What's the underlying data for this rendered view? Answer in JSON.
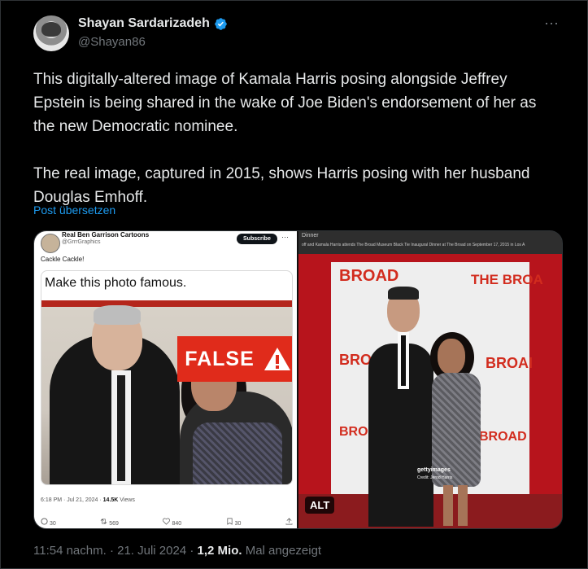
{
  "author": {
    "name": "Shayan Sardarizadeh",
    "handle": "@Shayan86"
  },
  "more_icon": "⋯",
  "tweet": {
    "text": "This digitally-altered image of Kamala Harris posing alongside Jeffrey Epstein is being shared in the wake of Joe Biden's endorsement of her as the new Democratic nominee.\n\nThe real image, captured in 2015, shows Harris posing with her husband Douglas Emhoff.",
    "translate_label": "Post übersetzen"
  },
  "media": {
    "left": {
      "account_name": "Real Ben Garrison Cartoons",
      "account_handle": "@GrrrGraphics",
      "subscribe_label": "Subscribe",
      "dots": "⋯",
      "post_text": "Cackle Cackle!",
      "quoted_text": "Make this photo famous.",
      "false_label": "FALSE",
      "meta_time": "6:18 PM · Jul 21, 2024 · ",
      "meta_views_count": "14.5K",
      "meta_views_label": " Views",
      "actions": {
        "replies": "30",
        "reposts": "569",
        "likes": "840",
        "bookmarks": "30"
      }
    },
    "right": {
      "header_title": "Dinner",
      "caption": "off and Kamala Harris attends The Broad Museum Black Tie Inaugural Dinner at The Broad on September 17, 2015 in Los A",
      "wall_text_1": "BROAD",
      "wall_text_2": "THE BROA",
      "wall_text_3": "BRO",
      "wall_text_4": "BROAI",
      "wall_text_5": "BROA",
      "wall_text_6": "BROAD",
      "getty_label": "gettyimages",
      "credit": "Credit: Jerod Harris",
      "alt_label": "ALT"
    }
  },
  "footer": {
    "time": "11:54 nachm. · 21. Juli 2024 · ",
    "views": "1,2 Mio.",
    "views_suffix": " Mal angezeigt"
  },
  "colors": {
    "background": "#000000",
    "text": "#e7e9ea",
    "muted": "#71767b",
    "link": "#1d9bf0",
    "false_badge": "#e02b1b"
  }
}
